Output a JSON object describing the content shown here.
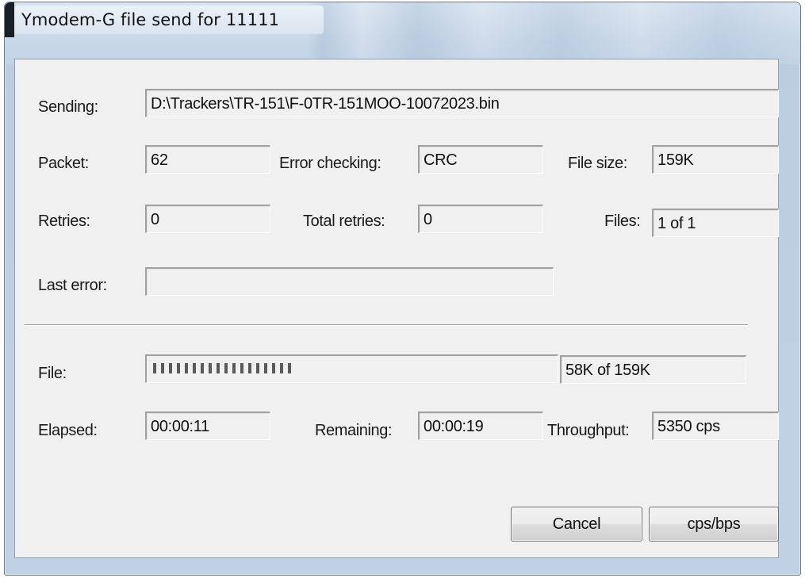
{
  "window": {
    "title": "Ymodem-G file send for 11111"
  },
  "sending": {
    "label": "Sending:",
    "value": "D:\\Trackers\\TR-151\\F-0TR-151MOO-10072023.bin"
  },
  "packet": {
    "label": "Packet:",
    "value": "62"
  },
  "error_checking": {
    "label": "Error checking:",
    "value": "CRC"
  },
  "file_size": {
    "label": "File size:",
    "value": "159K"
  },
  "retries": {
    "label": "Retries:",
    "value": "0"
  },
  "total_retries": {
    "label": "Total retries:",
    "value": "0"
  },
  "files": {
    "label": "Files:",
    "value": "1 of 1"
  },
  "last_error": {
    "label": "Last error:",
    "value": ""
  },
  "file_progress": {
    "label": "File:",
    "fraction": 0.365,
    "value": "58K of 159K"
  },
  "elapsed": {
    "label": "Elapsed:",
    "value": "00:00:11"
  },
  "remaining": {
    "label": "Remaining:",
    "value": "00:00:19"
  },
  "throughput": {
    "label": "Throughput:",
    "value": "5350 cps"
  },
  "buttons": {
    "cancel": "Cancel",
    "cps_bps": "cps/bps"
  }
}
